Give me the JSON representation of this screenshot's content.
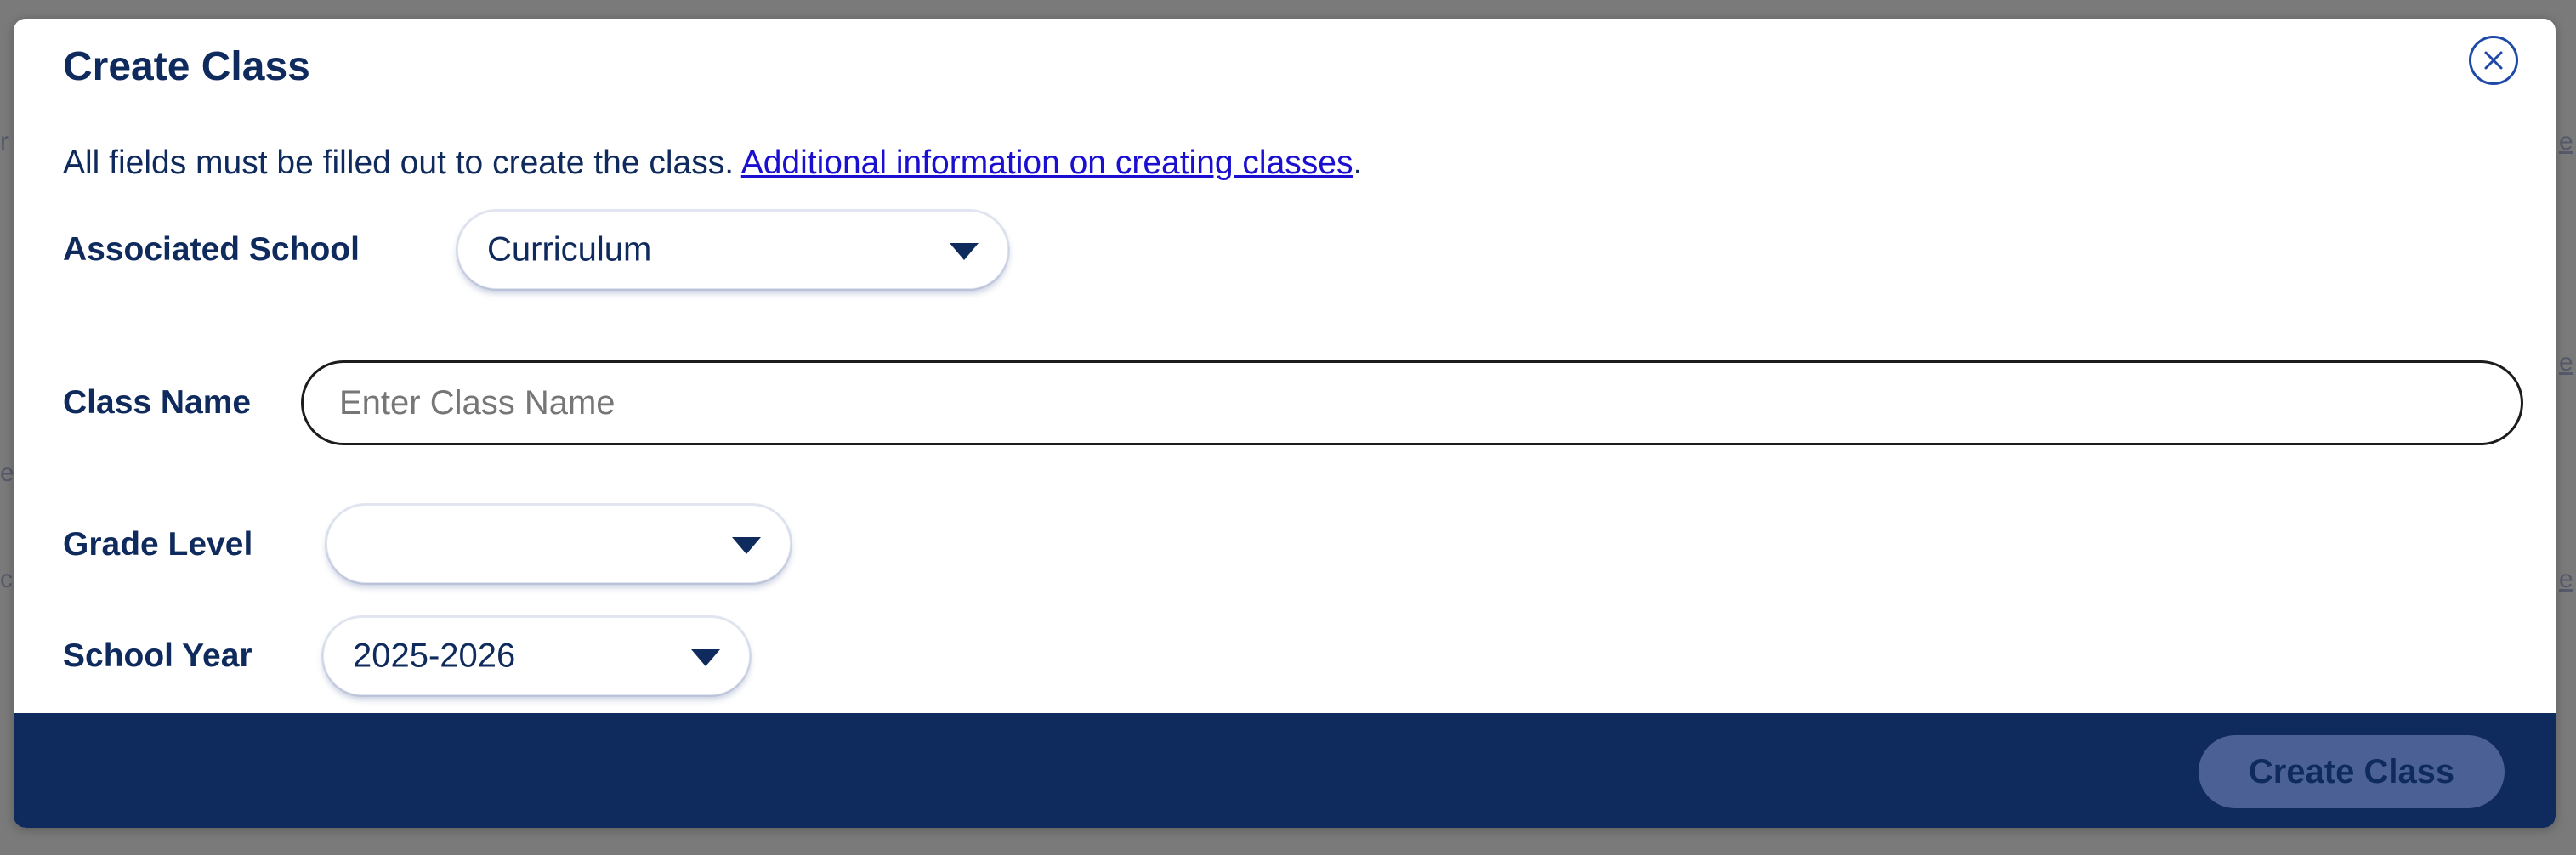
{
  "modal": {
    "title": "Create Class",
    "intro_text": "All fields must be filled out to create the class. ",
    "intro_link": "Additional information on creating classes",
    "intro_period": ".",
    "close_icon": "close-icon"
  },
  "fields": {
    "associated_school": {
      "label": "Associated School",
      "value": "Curriculum"
    },
    "class_name": {
      "label": "Class Name",
      "value": "",
      "placeholder": "Enter Class Name"
    },
    "grade_level": {
      "label": "Grade Level",
      "value": ""
    },
    "school_year": {
      "label": "School Year",
      "value": "2025-2026"
    }
  },
  "footer": {
    "create_label": "Create Class"
  },
  "colors": {
    "primary": "#0f2a5c",
    "link": "#1a0fd1",
    "button_disabled": "#4b6196",
    "overlay": "#7a7a7a"
  }
}
